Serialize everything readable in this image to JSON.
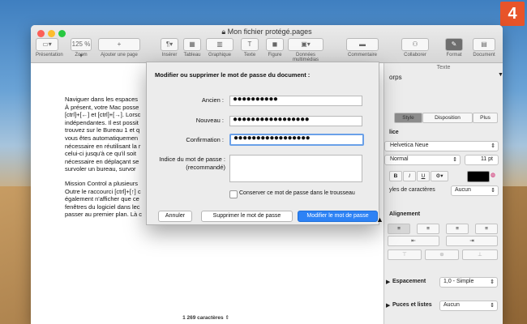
{
  "badge": "4",
  "window": {
    "title": "Mon fichier protégé.pages"
  },
  "toolbar": {
    "items": [
      {
        "label": "Présentation",
        "icon": "sidebar-icon",
        "glyph": "▭▾"
      },
      {
        "label": "Zoom",
        "icon": "zoom-icon",
        "glyph": "125 % ▾"
      },
      {
        "label": "Ajouter une page",
        "icon": "add-page-icon",
        "glyph": "+"
      },
      {
        "label": "Insérer",
        "icon": "insert-icon",
        "glyph": "¶▾"
      },
      {
        "label": "Tableau",
        "icon": "table-icon",
        "glyph": "▦"
      },
      {
        "label": "Graphique",
        "icon": "chart-icon",
        "glyph": "▥"
      },
      {
        "label": "Texte",
        "icon": "text-icon",
        "glyph": "T"
      },
      {
        "label": "Figure",
        "icon": "shape-icon",
        "glyph": "◼"
      },
      {
        "label": "Données multimédias",
        "icon": "media-icon",
        "glyph": "▣▾"
      },
      {
        "label": "Commentaire",
        "icon": "comment-icon",
        "glyph": "▬"
      },
      {
        "label": "Collaborer",
        "icon": "collaborate-icon",
        "glyph": "⚇"
      },
      {
        "label": "Format",
        "icon": "format-icon",
        "glyph": "✎"
      },
      {
        "label": "Document",
        "icon": "document-icon",
        "glyph": "▤"
      }
    ]
  },
  "document": {
    "paragraph1": "Naviguer dans les espaces\nÀ présent, votre Mac posse\n[ctrl]+[←] et [ctrl]+[→]. Lorsc\nindépendantes. Il est possit\ntrouvez sur le Bureau 1 et q\nvous êtes automatiquemen\nnécessaire en réutilisant la r\ncelui-ci jusqu'à ce qu'il soit\nnécessaire en déplaçant se\nsurvoler un bureau, survor",
    "paragraph2": "Mission Control a plusieurs\nOutre le raccourci [ctrl]+[↑] c\négalement n'afficher que ce\nfenêtres du logiciel dans lec\npasser au premier plan. Là c",
    "word_count": "1 269 caractères"
  },
  "panel": {
    "header": "Texte",
    "style_name": "orps",
    "tabs": [
      "Style",
      "Disposition",
      "Plus"
    ],
    "font_section": "lice",
    "font_name": "Helvetica Neue",
    "font_style": "Normal",
    "font_size": "11 pt",
    "bold": "B",
    "italic": "I",
    "underline": "U",
    "gear": "⚙▾",
    "char_styles_label": "yles de caractères",
    "char_styles_value": "Aucun",
    "alignment_label": "Alignement",
    "spacing_label": "Espacement",
    "spacing_value": "1,0 - Simple",
    "bullets_label": "Puces et listes",
    "bullets_value": "Aucun",
    "text_color": "#000000"
  },
  "dialog": {
    "title": "Modifier ou supprimer le mot de passe du document :",
    "old_label": "Ancien :",
    "old_value": "●●●●●●●●●●",
    "new_label": "Nouveau :",
    "new_value": "●●●●●●●●●●●●●●●●●",
    "confirm_label": "Confirmation :",
    "confirm_value": "●●●●●●●●●●●●●●●●●",
    "hint_label": "Indice du mot de passe :",
    "hint_sub": "(recommandé)",
    "hint_value": "",
    "keychain_label": "Conserver ce mot de passe dans le trousseau",
    "cancel": "Annuler",
    "remove": "Supprimer le mot de passe",
    "change": "Modifier le mot de passe"
  }
}
